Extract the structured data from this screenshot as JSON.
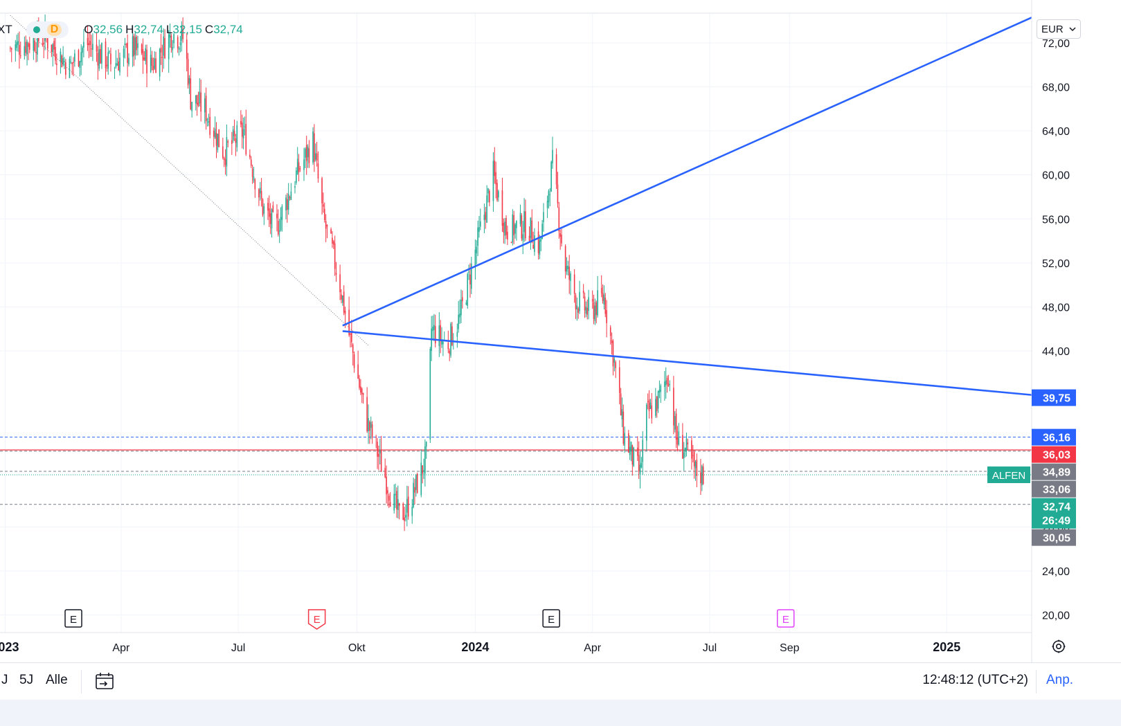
{
  "header": {
    "symbol_fragment": "XT",
    "interval": "D",
    "open_key": "O",
    "open_value": "32,56",
    "high_key": "H",
    "high_value": "32,74",
    "low_key": "L",
    "low_value": "32,15",
    "close_key": "C",
    "close_value": "32,74",
    "currency": "EUR"
  },
  "colors": {
    "up": "#22ab94",
    "down": "#f23645",
    "trendline": "#2962ff",
    "grid": "#f0f3fa",
    "text": "#131722",
    "adj": "#2962ff"
  },
  "chart_data": {
    "type": "candlestick",
    "symbol_label": "ALFEN",
    "currency": "EUR",
    "y_ticks": [
      "72,00",
      "68,00",
      "64,00",
      "60,00",
      "56,00",
      "52,00",
      "48,00",
      "44,00",
      "28,00",
      "24,00",
      "20,00"
    ],
    "y_tick_values": [
      72,
      68,
      64,
      60,
      56,
      52,
      48,
      44,
      28,
      24,
      20
    ],
    "x_ticks": [
      "2023",
      "Apr",
      "Jul",
      "Okt",
      "2024",
      "Apr",
      "Jul",
      "Sep",
      "2025"
    ],
    "x_tick_dates": [
      "2023-01-01",
      "2023-04-01",
      "2023-07-01",
      "2023-10-01",
      "2024-01-01",
      "2024-04-01",
      "2024-07-01",
      "2024-09-01",
      "2025-01-01"
    ],
    "ylim": [
      18.4,
      74.7
    ],
    "xlim": [
      "2022-12-28",
      "2025-03-08"
    ],
    "grid": true,
    "price_path": [
      [
        "2023-01-05",
        71.5
      ],
      [
        "2023-02-01",
        72.5
      ],
      [
        "2023-02-20",
        69.8
      ],
      [
        "2023-03-05",
        72.0
      ],
      [
        "2023-03-25",
        70.0
      ],
      [
        "2023-04-10",
        71.5
      ],
      [
        "2023-04-25",
        70.0
      ],
      [
        "2023-05-10",
        72.8
      ],
      [
        "2023-05-20",
        72.4
      ],
      [
        "2023-05-25",
        67.0
      ],
      [
        "2023-06-05",
        66.0
      ],
      [
        "2023-06-20",
        62.0
      ],
      [
        "2023-07-05",
        64.0
      ],
      [
        "2023-07-20",
        57.0
      ],
      [
        "2023-07-30",
        55.0
      ],
      [
        "2023-08-15",
        60.0
      ],
      [
        "2023-08-28",
        63.0
      ],
      [
        "2023-09-05",
        56.0
      ],
      [
        "2023-09-12",
        53.0
      ],
      [
        "2023-09-18",
        50.0
      ],
      [
        "2023-09-25",
        45.5
      ],
      [
        "2023-10-01",
        42.0
      ],
      [
        "2023-10-08",
        38.0
      ],
      [
        "2023-10-15",
        35.5
      ],
      [
        "2023-10-22",
        33.0
      ],
      [
        "2023-10-30",
        30.0
      ],
      [
        "2023-11-03",
        29.0
      ],
      [
        "2023-11-08",
        29.5
      ],
      [
        "2023-11-14",
        31.0
      ],
      [
        "2023-11-20",
        33.0
      ],
      [
        "2023-11-24",
        34.5
      ],
      [
        "2023-11-28",
        46.0
      ],
      [
        "2023-12-10",
        44.5
      ],
      [
        "2023-12-20",
        47.0
      ],
      [
        "2024-01-05",
        55.0
      ],
      [
        "2024-01-15",
        60.0
      ],
      [
        "2024-01-25",
        55.0
      ],
      [
        "2024-02-10",
        55.5
      ],
      [
        "2024-02-20",
        53.5
      ],
      [
        "2024-03-01",
        61.0
      ],
      [
        "2024-03-10",
        52.0
      ],
      [
        "2024-03-20",
        48.5
      ],
      [
        "2024-03-30",
        47.5
      ],
      [
        "2024-04-10",
        49.0
      ],
      [
        "2024-04-18",
        43.0
      ],
      [
        "2024-04-25",
        36.5
      ],
      [
        "2024-05-03",
        34.0
      ],
      [
        "2024-05-08",
        32.8
      ],
      [
        "2024-05-12",
        38.0
      ],
      [
        "2024-05-22",
        39.5
      ],
      [
        "2024-05-30",
        42.0
      ],
      [
        "2024-06-05",
        36.0
      ],
      [
        "2024-06-12",
        35.0
      ],
      [
        "2024-06-20",
        33.0
      ],
      [
        "2024-06-27",
        32.74
      ]
    ],
    "trendlines": [
      {
        "from": [
          "2023-09-20",
          46.3
        ],
        "to": [
          "2025-03-08",
          74.3
        ]
      },
      {
        "from": [
          "2023-09-20",
          45.8
        ],
        "to": [
          "2025-03-08",
          40.0
        ]
      }
    ],
    "dotted_line": {
      "from": [
        "2023-01-05",
        74.5
      ],
      "to": [
        "2023-10-10",
        44.5
      ]
    },
    "horizontal_levels": [
      {
        "value": 36.16,
        "label": "36,16",
        "label_color": "#2962ff",
        "line_color": "#2962ff",
        "style": "dashed"
      },
      {
        "value": 34.89,
        "label": "34,89",
        "label_color": "#787b86",
        "line_color": "#787b86",
        "style": "dashed"
      },
      {
        "value": 33.06,
        "label": "33,06",
        "label_color": "#787b86",
        "line_color": "#787b86",
        "style": "dashed"
      },
      {
        "value": 30.05,
        "label": "30,05",
        "label_color": "#787b86",
        "line_color": "#787b86",
        "style": "dashed"
      }
    ],
    "price_labels": [
      {
        "value": 39.75,
        "label": "39,75",
        "color": "#2962ff"
      },
      {
        "value": 36.16,
        "label": "36,16",
        "color": "#2962ff"
      },
      {
        "value": 35.0,
        "label": "36,03",
        "color": "#f23645"
      },
      {
        "value": 34.89,
        "label": "34,89",
        "color": "#787b86"
      },
      {
        "value": 33.06,
        "label": "33,06",
        "color": "#787b86"
      },
      {
        "value": 32.74,
        "label": "32,74",
        "color": "#22ab94",
        "sub": "26:49"
      },
      {
        "value": 30.05,
        "label": "30,05",
        "color": "#787b86"
      }
    ],
    "red_line_value": 35.0,
    "last_price": 32.74,
    "countdown": "26:49",
    "earnings_markers": [
      {
        "date": "2023-02-23",
        "label": "E",
        "kind": "past"
      },
      {
        "date": "2023-08-31",
        "label": "E",
        "kind": "negative"
      },
      {
        "date": "2024-02-29",
        "label": "E",
        "kind": "past"
      },
      {
        "date": "2024-08-29",
        "label": "E",
        "kind": "future"
      }
    ]
  },
  "bottom_bar": {
    "range_1": "J",
    "range_2": "5J",
    "range_3": "Alle",
    "clock": "12:48:12 (UTC+2)",
    "adjust": "Anp."
  }
}
